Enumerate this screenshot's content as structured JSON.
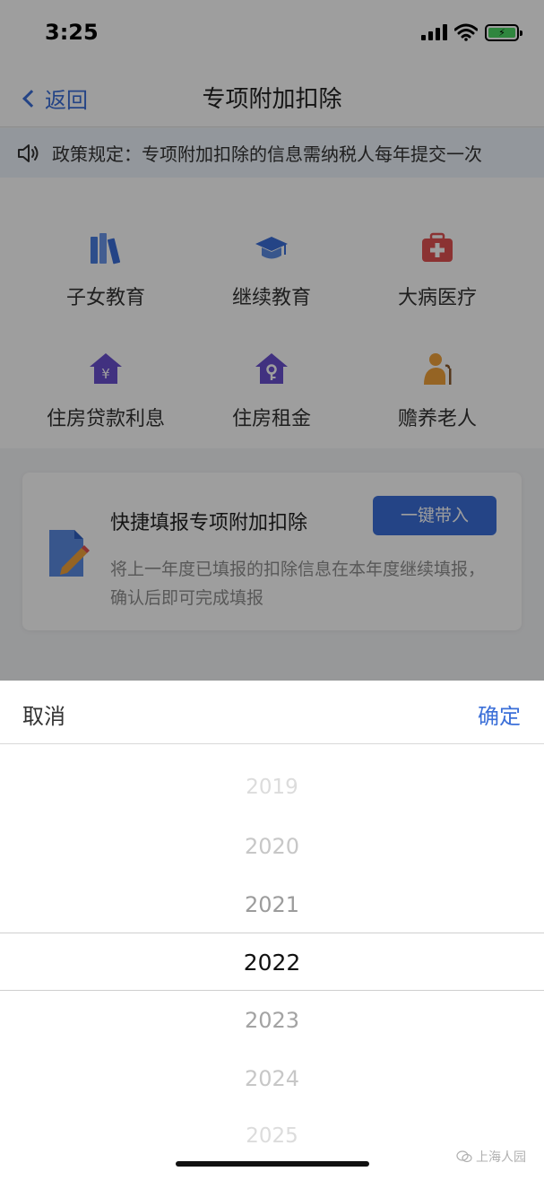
{
  "status_bar": {
    "time": "3:25"
  },
  "nav": {
    "back_label": "返回",
    "title": "专项附加扣除"
  },
  "notice": {
    "text": "政策规定：专项附加扣除的信息需纳税人每年提交一次"
  },
  "categories": [
    {
      "label": "子女教育",
      "icon": "books-icon",
      "color": "#4a7fe0"
    },
    {
      "label": "继续教育",
      "icon": "graduation-cap-icon",
      "color": "#3b6fd8"
    },
    {
      "label": "大病医疗",
      "icon": "medical-kit-icon",
      "color": "#e05252"
    },
    {
      "label": "住房贷款利息",
      "icon": "house-yen-icon",
      "color": "#6a4fcf"
    },
    {
      "label": "住房租金",
      "icon": "house-key-icon",
      "color": "#6a4fcf"
    },
    {
      "label": "赡养老人",
      "icon": "elder-icon",
      "color": "#f0a23a"
    }
  ],
  "quick_fill": {
    "title": "快捷填报专项附加扣除",
    "button": "一键带入",
    "description": "将上一年度已填报的扣除信息在本年度继续填报，确认后即可完成填报"
  },
  "picker": {
    "cancel_label": "取消",
    "confirm_label": "确定",
    "years": [
      "2019",
      "2020",
      "2021",
      "2022",
      "2023",
      "2024",
      "2025"
    ],
    "selected": "2022"
  },
  "watermark": {
    "text": "上海人园"
  },
  "colors": {
    "accent": "#3b6fd8"
  }
}
